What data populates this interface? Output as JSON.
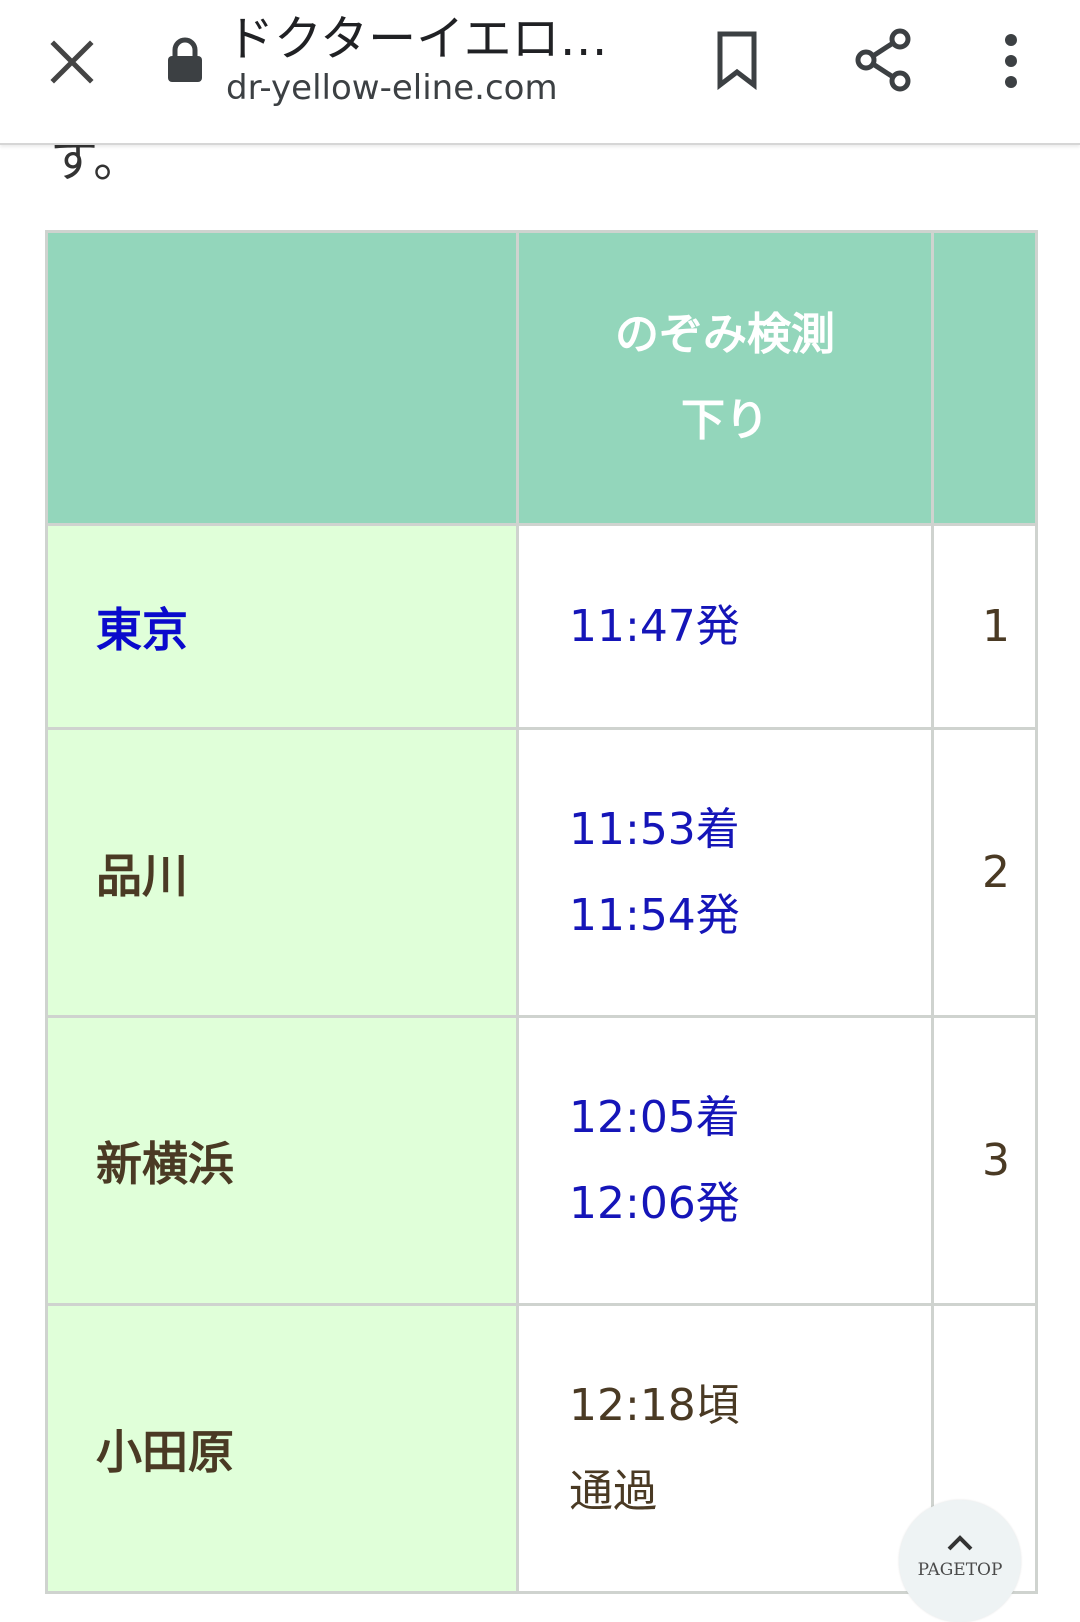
{
  "browser": {
    "page_title": "ドクターイエロ…",
    "url": "dr-yellow-eline.com",
    "icons": {
      "close": "close-icon",
      "lock": "lock-icon",
      "bookmark": "bookmark-icon",
      "share": "share-icon",
      "more": "more-vert-icon"
    }
  },
  "content": {
    "cutoff_text": "す。"
  },
  "timetable": {
    "header": {
      "col1": "",
      "col2_line1": "のぞみ検測",
      "col2_line2": "下り",
      "col3": ""
    },
    "rows": [
      {
        "station": "東京",
        "linked": true,
        "times": [
          "11:47発"
        ],
        "extra": "1"
      },
      {
        "station": "品川",
        "linked": false,
        "times": [
          "11:53着",
          "11:54発"
        ],
        "extra": "2"
      },
      {
        "station": "新横浜",
        "linked": false,
        "times": [
          "12:05着",
          "12:06発"
        ],
        "extra": "3"
      },
      {
        "station": "小田原",
        "linked": false,
        "times": [
          "12:18頃",
          "通過"
        ],
        "extra": ""
      }
    ]
  },
  "pagetop": {
    "label": "PAGETOP"
  },
  "colors": {
    "header_bg": "#93d6bb",
    "station_bg": "#e0ffd9",
    "time_text": "#1515b8",
    "link_text": "#0a0acc",
    "body_text": "#4a3a24"
  }
}
